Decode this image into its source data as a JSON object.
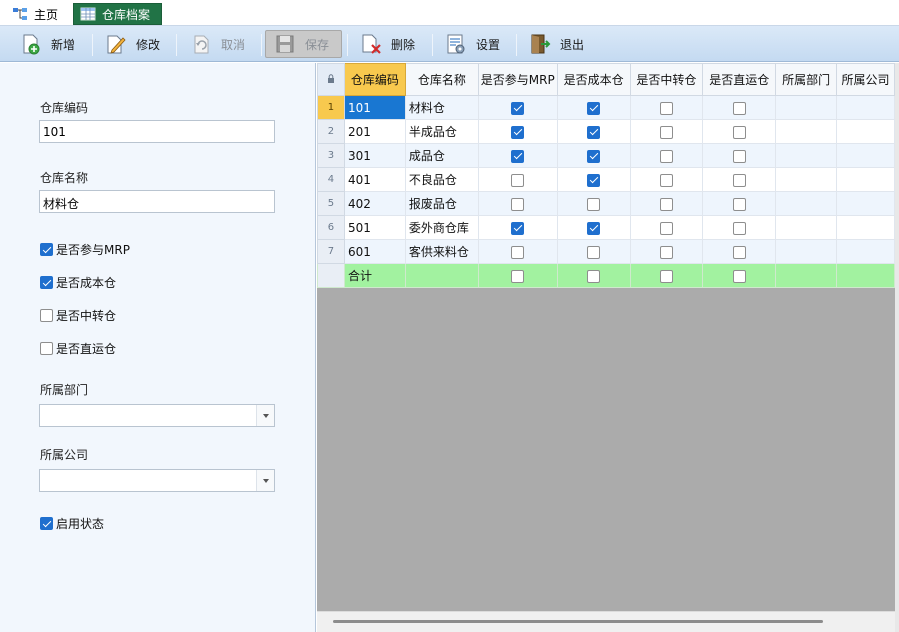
{
  "tabs": [
    {
      "label": "主页",
      "icon": "hierarchy-icon"
    },
    {
      "label": "仓库档案",
      "icon": "table-icon",
      "active": true
    }
  ],
  "toolbar": {
    "new_label": "新增",
    "edit_label": "修改",
    "cancel_label": "取消",
    "save_label": "保存",
    "delete_label": "删除",
    "settings_label": "设置",
    "exit_label": "退出"
  },
  "form": {
    "code_label": "仓库编码",
    "code_value": "101",
    "name_label": "仓库名称",
    "name_value": "材料仓",
    "mrp_label": "是否参与MRP",
    "mrp_checked": true,
    "cost_label": "是否成本仓",
    "cost_checked": true,
    "transit_label": "是否中转仓",
    "transit_checked": false,
    "direct_label": "是否直运仓",
    "direct_checked": false,
    "dept_label": "所属部门",
    "dept_value": "",
    "company_label": "所属公司",
    "company_value": "",
    "enabled_label": "启用状态",
    "enabled_checked": true
  },
  "grid": {
    "corner_icon": "lock-icon",
    "columns": [
      "仓库编码",
      "仓库名称",
      "是否参与MRP",
      "是否成本仓",
      "是否中转仓",
      "是否直运仓",
      "所属部门",
      "所属公司"
    ],
    "rows": [
      {
        "num": "1",
        "code": "101",
        "name": "材料仓",
        "mrp": true,
        "cost": true,
        "transit": false,
        "direct": false
      },
      {
        "num": "2",
        "code": "201",
        "name": "半成品仓",
        "mrp": true,
        "cost": true,
        "transit": false,
        "direct": false
      },
      {
        "num": "3",
        "code": "301",
        "name": "成品仓",
        "mrp": true,
        "cost": true,
        "transit": false,
        "direct": false
      },
      {
        "num": "4",
        "code": "401",
        "name": "不良品仓",
        "mrp": false,
        "cost": true,
        "transit": false,
        "direct": false
      },
      {
        "num": "5",
        "code": "402",
        "name": "报废品仓",
        "mrp": false,
        "cost": false,
        "transit": false,
        "direct": false
      },
      {
        "num": "6",
        "code": "501",
        "name": "委外商仓库",
        "mrp": true,
        "cost": true,
        "transit": false,
        "direct": false
      },
      {
        "num": "7",
        "code": "601",
        "name": "客供来料仓",
        "mrp": false,
        "cost": false,
        "transit": false,
        "direct": false
      }
    ],
    "total_label": "合计"
  },
  "colors": {
    "tab_active": "#217346",
    "checkbox_on": "#1f6fce",
    "selected_header": "#f8c94e",
    "active_cell": "#1977d2",
    "total_row": "#a2f2a0",
    "grid_empty": "#ababab"
  }
}
